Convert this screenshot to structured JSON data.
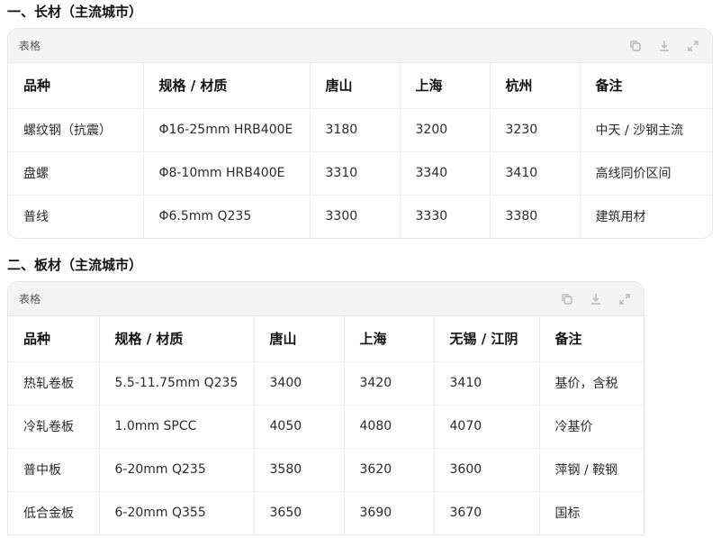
{
  "section1": {
    "title": "一、长材（主流城市）",
    "table_label": "表格",
    "headers": [
      "品种",
      "规格 / 材质",
      "唐山",
      "上海",
      "杭州",
      "备注"
    ],
    "rows": [
      [
        "螺纹钢（抗震）",
        "Φ16-25mm HRB400E",
        "3180",
        "3200",
        "3230",
        "中天 / 沙钢主流"
      ],
      [
        "盘螺",
        "Φ8-10mm HRB400E",
        "3310",
        "3340",
        "3410",
        "高线同价区间"
      ],
      [
        "普线",
        "Φ6.5mm Q235",
        "3300",
        "3330",
        "3380",
        "建筑用材"
      ]
    ]
  },
  "section2": {
    "title": "二、板材（主流城市）",
    "table_label": "表格",
    "headers": [
      "品种",
      "规格 / 材质",
      "唐山",
      "上海",
      "无锡 / 江阴",
      "备注"
    ],
    "rows": [
      [
        "热轧卷板",
        "5.5-11.75mm Q235",
        "3400",
        "3420",
        "3410",
        "基价，含税"
      ],
      [
        "冷轧卷板",
        "1.0mm SPCC",
        "4050",
        "4080",
        "4070",
        "冷基价"
      ],
      [
        "普中板",
        "6-20mm Q235",
        "3580",
        "3620",
        "3600",
        "萍钢 / 鞍钢"
      ],
      [
        "低合金板",
        "6-20mm Q355",
        "3650",
        "3690",
        "3670",
        "国标"
      ]
    ]
  },
  "icons": [
    "copy-icon",
    "download-icon",
    "expand-icon"
  ]
}
